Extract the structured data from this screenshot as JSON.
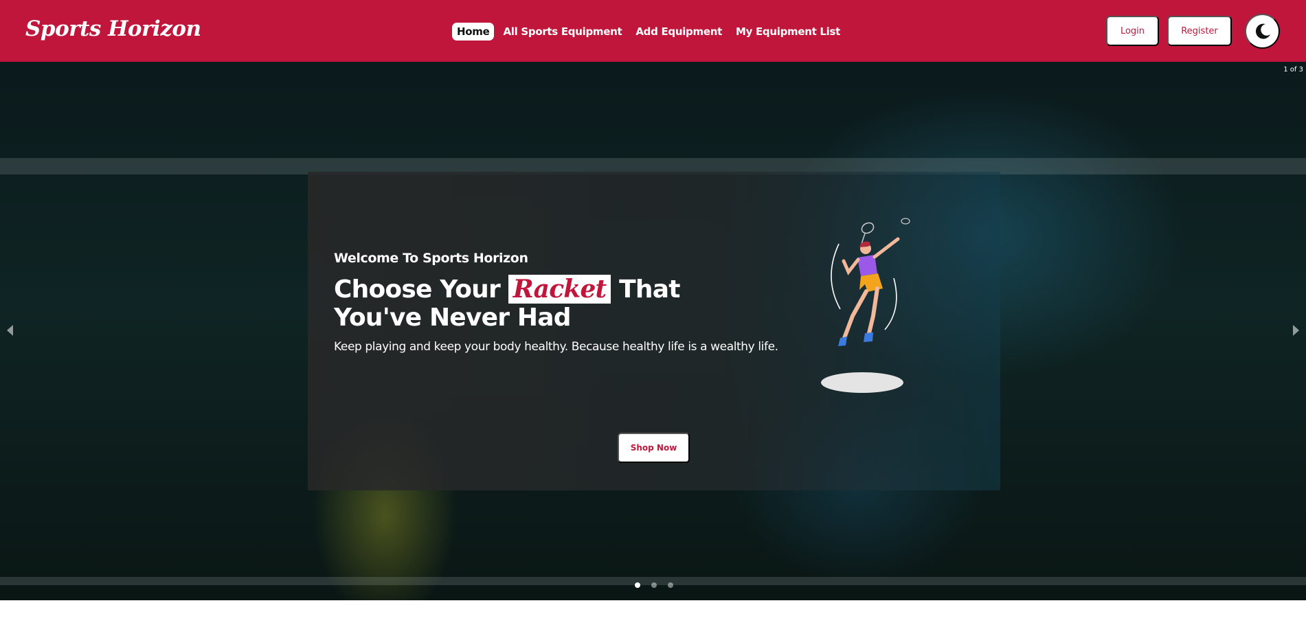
{
  "brand": {
    "name": "Sports Horizon"
  },
  "nav": {
    "links": [
      "Home",
      "All Sports Equipment",
      "Add Equipment",
      "My Equipment List"
    ],
    "active": "Home"
  },
  "auth": {
    "login_label": "Login",
    "register_label": "Register"
  },
  "theme_toggle": {
    "icon": "moon-icon"
  },
  "carousel": {
    "counter": "1 of 3",
    "current_slide": 1,
    "total_slides": 3,
    "prev_icon": "chevron-left-icon",
    "next_icon": "chevron-right-icon"
  },
  "hero": {
    "kicker": "Welcome To Sports Horizon",
    "headline_before": "Choose Your",
    "headline_highlight": "Racket",
    "headline_after": "That You've Never Had",
    "subtitle": "Keep playing and keep your body healthy. Because healthy life is a wealthy life.",
    "cta_label": "Shop Now",
    "illustration": "badminton-player-illustration"
  },
  "colors": {
    "brand": "#c0163c",
    "white": "#ffffff"
  }
}
